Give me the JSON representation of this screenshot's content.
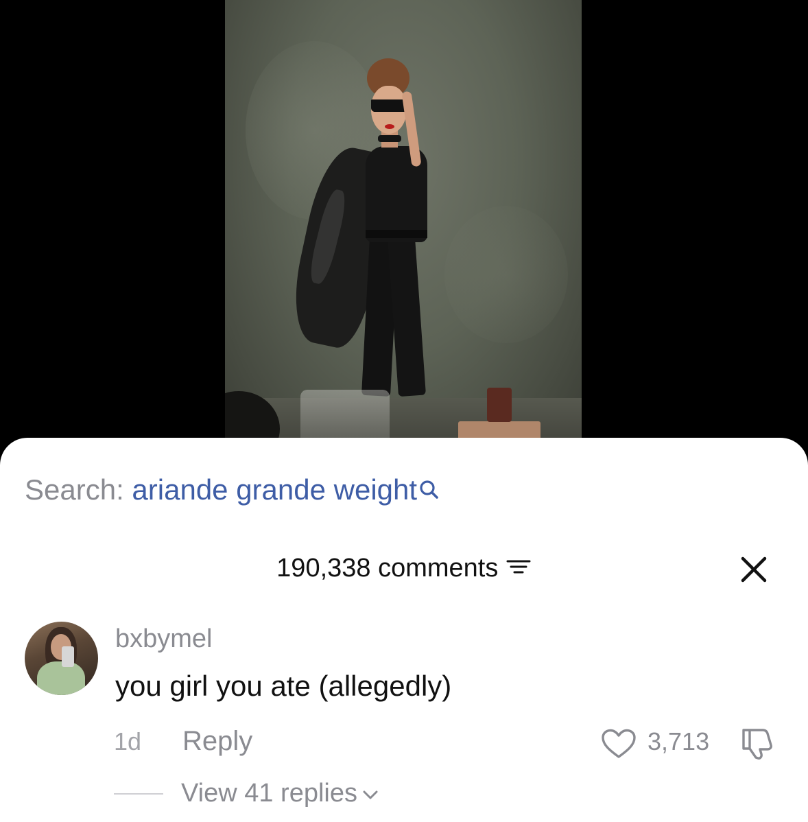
{
  "search": {
    "label": "Search:",
    "query": "ariande grande weight",
    "icon": "search-icon"
  },
  "comments": {
    "count_label": "190,338 comments",
    "filter_icon": "filter-icon",
    "close_icon": "close-icon"
  },
  "comment": {
    "username": "bxbymel",
    "text": "you girl you ate (allegedly)",
    "age": "1d",
    "reply_label": "Reply",
    "likes": "3,713",
    "like_icon": "heart-icon",
    "dislike_icon": "thumbs-down-icon",
    "view_replies_label": "View 41 replies"
  },
  "colors": {
    "search_query": "#3e5da6",
    "muted_text": "#8a8b91",
    "sheet_bg": "#ffffff",
    "video_bg": "#000000"
  }
}
